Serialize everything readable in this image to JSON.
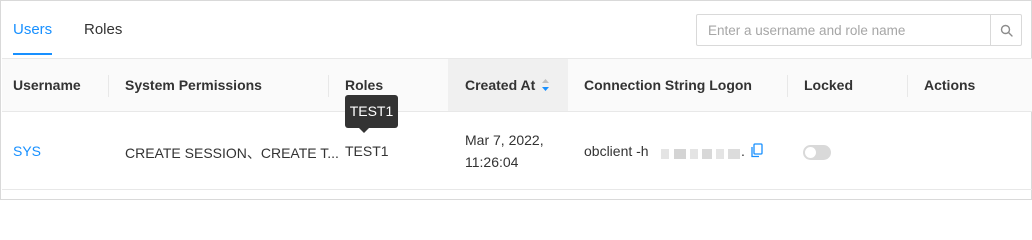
{
  "tabs": [
    {
      "label": "Users",
      "active": true
    },
    {
      "label": "Roles",
      "active": false
    }
  ],
  "search": {
    "placeholder": "Enter a username and role name",
    "value": "",
    "icon": "search-icon"
  },
  "table": {
    "columns": [
      "Username",
      "System Permissions",
      "Roles",
      "Created At",
      "Connection String Logon",
      "Locked",
      "Actions"
    ],
    "sorted_column": "Created At",
    "sort_direction": "descending",
    "rows": [
      {
        "username": "SYS",
        "system_permissions": "CREATE SESSION、CREATE T...",
        "roles": "TEST1",
        "created_at_date": "Mar 7, 2022,",
        "created_at_time": "11:26:04",
        "connection_string": "obclient -h",
        "connection_suffix": ".",
        "locked": false
      }
    ]
  },
  "tooltip": {
    "text": "TEST1"
  },
  "colors": {
    "accent": "#1890ff",
    "header_bg": "#fafafa",
    "border": "#e8e8e8",
    "tooltip_bg": "#333333"
  }
}
